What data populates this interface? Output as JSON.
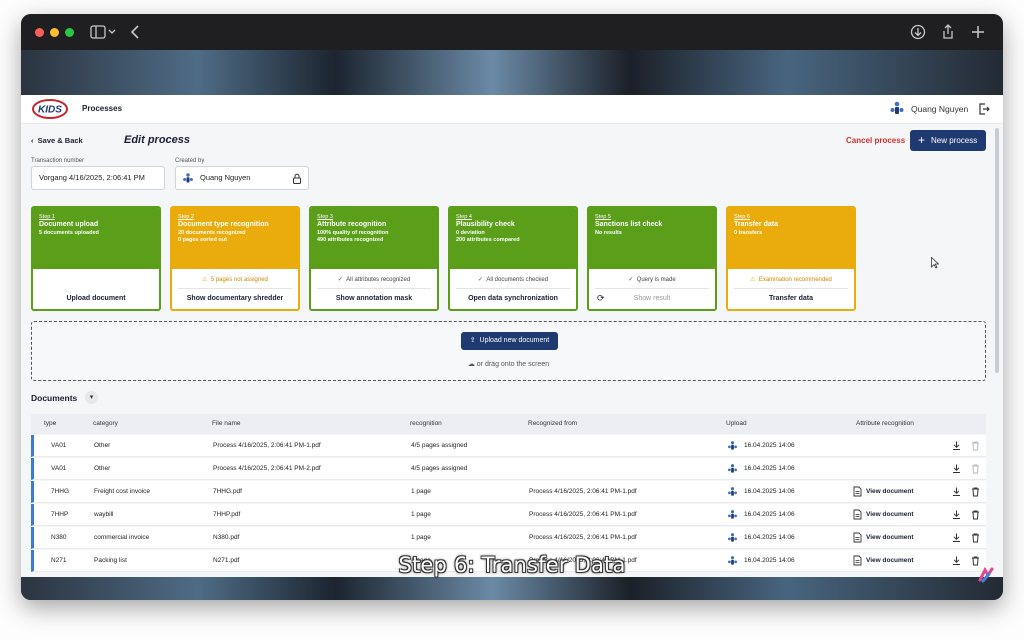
{
  "app": {
    "logo_text": "KIDS",
    "nav_title": "Processes",
    "user_name": "Quang Nguyen"
  },
  "header": {
    "back_label": "Save & Back",
    "title": "Edit process",
    "cancel_label": "Cancel process",
    "new_label": "New process"
  },
  "fields": {
    "transaction_label": "Transaction number",
    "transaction_value": "Vorgang 4/16/2025, 2:06:41 PM",
    "created_by_label": "Created by",
    "created_by_value": "Quang Nguyen"
  },
  "steps": [
    {
      "no": "Step 1",
      "title": "Document upload",
      "line1": "5 documents uploaded",
      "line2": "",
      "status": "",
      "action": "Upload document",
      "color": "#5a9e1a"
    },
    {
      "no": "Step 2",
      "title": "Document type recognition",
      "line1": "20 documents recognized",
      "line2": "0 pages sorted out",
      "status": "5 pages not assigned",
      "action": "Show documentary shredder",
      "color": "#e9ac0c"
    },
    {
      "no": "Step 3",
      "title": "Attribute recognition",
      "line1": "100% quality of recognition",
      "line2": "490 attributes recognized",
      "status": "All attributes recognized",
      "action": "Show annotation mask",
      "color": "#5a9e1a"
    },
    {
      "no": "Step 4",
      "title": "Plausibility check",
      "line1": "0 deviation",
      "line2": "200 attributes compared",
      "status": "All documents checked",
      "action": "Open data synchronization",
      "color": "#5a9e1a"
    },
    {
      "no": "Step 5",
      "title": "Sanctions list check",
      "line1": "No results",
      "line2": "",
      "status": "Query is made",
      "action": "Show result",
      "color": "#5a9e1a"
    },
    {
      "no": "Step 6",
      "title": "Transfer data",
      "line1": "0 transfers",
      "line2": "",
      "status": "Examination recommended",
      "action": "Transfer data",
      "color": "#e9ac0c"
    }
  ],
  "dropzone": {
    "upload_label": "Upload new document",
    "drag_label": "or drag onto the screen"
  },
  "documents": {
    "title": "Documents",
    "columns": [
      "type",
      "category",
      "File name",
      "recognition",
      "Recognized from",
      "Upload",
      "Attribute recognition"
    ],
    "rows": [
      {
        "type": "VA01",
        "category": "Other",
        "file": "Process 4/16/2025, 2:06:41 PM-1.pdf",
        "recognition": "4/5 pages assigned",
        "from": "",
        "upload": "16.04.2025 14:06",
        "view": ""
      },
      {
        "type": "VA01",
        "category": "Other",
        "file": "Process 4/16/2025, 2:06:41 PM-2.pdf",
        "recognition": "4/5 pages assigned",
        "from": "",
        "upload": "16.04.2025 14:06",
        "view": ""
      },
      {
        "type": "7HHG",
        "category": "Freight cost invoice",
        "file": "7HHG.pdf",
        "recognition": "1 page",
        "from": "Process 4/16/2025, 2:06:41 PM-1.pdf",
        "upload": "16.04.2025 14:06",
        "view": "View document"
      },
      {
        "type": "7HHP",
        "category": "waybill",
        "file": "7HHP.pdf",
        "recognition": "1 page",
        "from": "Process 4/16/2025, 2:06:41 PM-1.pdf",
        "upload": "16.04.2025 14:06",
        "view": "View document"
      },
      {
        "type": "N380",
        "category": "commercial invoice",
        "file": "N380.pdf",
        "recognition": "1 page",
        "from": "Process 4/16/2025, 2:06:41 PM-1.pdf",
        "upload": "16.04.2025 14:06",
        "view": "View document"
      },
      {
        "type": "N271",
        "category": "Packing list",
        "file": "N271.pdf",
        "recognition": "1 page",
        "from": "Process 4/16/2025, 2:06:41 PM-1.pdf",
        "upload": "16.04.2025 14:06",
        "view": "View document"
      }
    ]
  },
  "caption": "Step 6: Transfer Data",
  "colors": {
    "green": "#5a9e1a",
    "amber": "#e9ac0c",
    "navy": "#1f3a70",
    "danger": "#d32f2f"
  }
}
